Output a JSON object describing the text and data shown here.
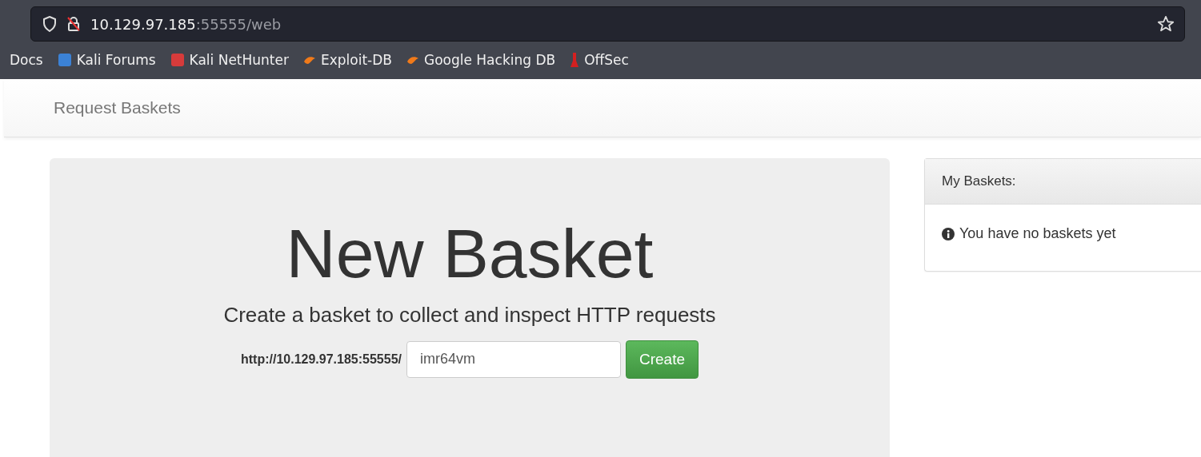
{
  "browser": {
    "address": {
      "host": "10.129.97.185",
      "rest": ":55555/web"
    },
    "bookmarks": [
      {
        "label": "Docs",
        "kind": "none"
      },
      {
        "label": "Kali Forums",
        "kind": "badge",
        "color": "#3b82d6"
      },
      {
        "label": "Kali NetHunter",
        "kind": "badge",
        "color": "#d63b3b"
      },
      {
        "label": "Exploit-DB",
        "kind": "flame",
        "color": "#f07a1a"
      },
      {
        "label": "Google Hacking DB",
        "kind": "flame",
        "color": "#f07a1a"
      },
      {
        "label": "OffSec",
        "kind": "flask",
        "color": "#d42020"
      }
    ]
  },
  "navbar": {
    "brand": "Request Baskets"
  },
  "jumbotron": {
    "title": "New Basket",
    "subtitle": "Create a basket to collect and inspect HTTP requests",
    "prefix": "http://10.129.97.185:55555/",
    "basket_name": "imr64vm",
    "button": "Create"
  },
  "panel": {
    "title": "My Baskets:",
    "message": "You have no baskets yet"
  }
}
